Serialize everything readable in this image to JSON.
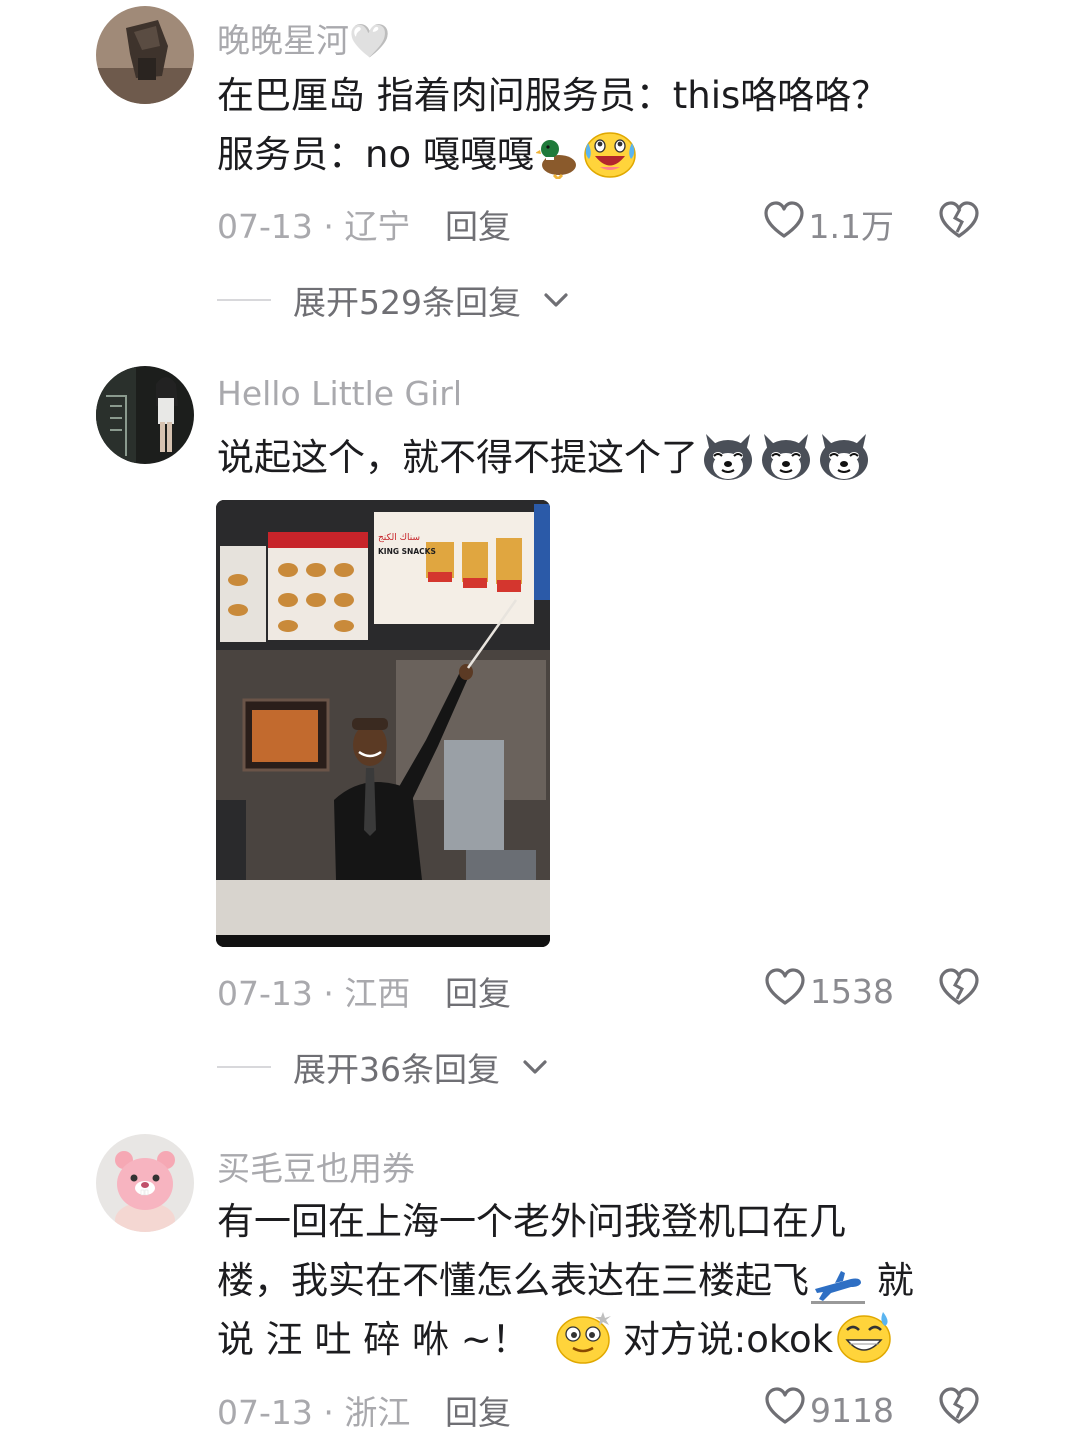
{
  "comments": [
    {
      "username": "晚晚星河🤍",
      "text_lines": [
        "在巴厘岛 指着肉问服务员：this咯咯咯？",
        "服务员：no 嘎嘎嘎"
      ],
      "emojis": [
        "duck-emoji",
        "laughing-tears-emoji"
      ],
      "date": "07-13",
      "location": "辽宁",
      "reply_label": "回复",
      "likes": "1.1万",
      "expand_label": "展开529条回复"
    },
    {
      "username": "Hello  Little  Girl",
      "text_lines": [
        "说起这个，就不得不提这个了"
      ],
      "emojis": [
        "shiba-dog-emoji",
        "shiba-dog-emoji",
        "shiba-dog-emoji"
      ],
      "image_signage": {
        "arabic": "سناك الكنج",
        "english": "KING SNACKS"
      },
      "date": "07-13",
      "location": "江西",
      "reply_label": "回复",
      "likes": "1538",
      "expand_label": "展开36条回复"
    },
    {
      "username": "买毛豆也用券",
      "text_lines": [
        "有一回在上海一个老外问我登机口在几",
        "楼，我实在不懂怎么表达在三楼起飞",
        "说 汪 吐 碎  咻 ~！",
        "对方说:okok"
      ],
      "line2_suffix": " 就",
      "emojis": [
        "airplane-emoji",
        "dizzy-face-emoji",
        "grinning-sweat-emoji"
      ],
      "date": "07-13",
      "location": "浙江",
      "reply_label": "回复",
      "likes": "9118"
    }
  ],
  "meta_separator": " · ",
  "colors": {
    "text_primary": "#1c1c1f",
    "text_secondary": "#a9a9ad",
    "text_action": "#6f6f74",
    "background": "#ffffff"
  }
}
